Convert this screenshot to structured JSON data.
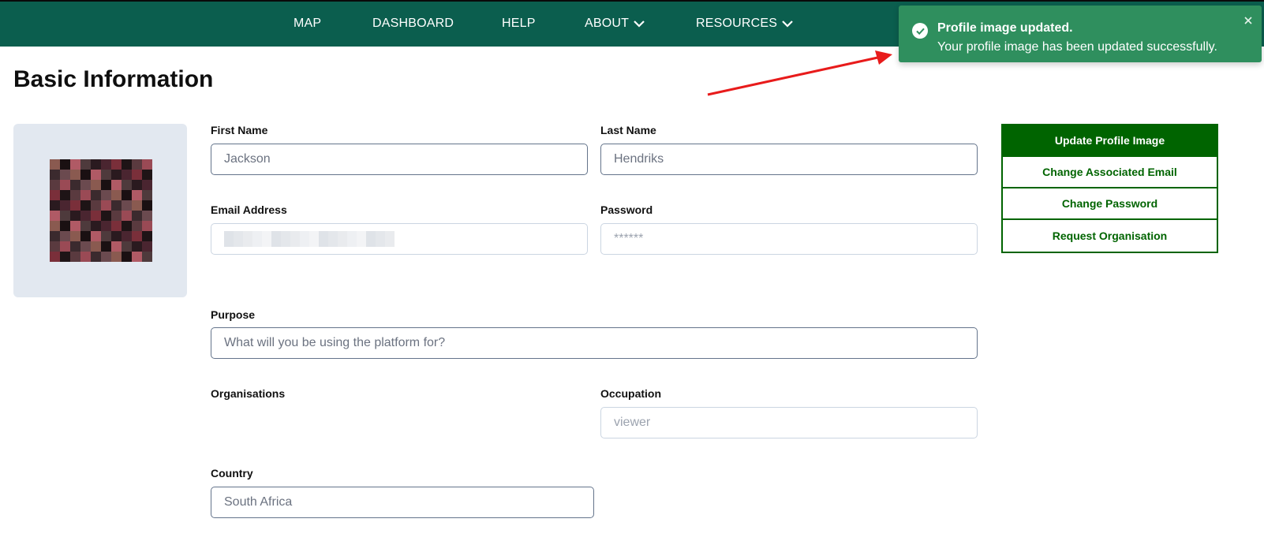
{
  "nav": {
    "items": [
      {
        "label": "MAP",
        "has_dropdown": false
      },
      {
        "label": "DASHBOARD",
        "has_dropdown": false
      },
      {
        "label": "HELP",
        "has_dropdown": false
      },
      {
        "label": "ABOUT",
        "has_dropdown": true,
        "icon": "chevron-down-icon"
      },
      {
        "label": "RESOURCES",
        "has_dropdown": true,
        "icon": "chevron-down-icon"
      }
    ],
    "background": "#0b5e4e"
  },
  "page": {
    "title": "Basic Information"
  },
  "form": {
    "first_name": {
      "label": "First Name",
      "value": "Jackson"
    },
    "last_name": {
      "label": "Last Name",
      "value": "Hendriks"
    },
    "email": {
      "label": "Email Address",
      "value": ""
    },
    "password": {
      "label": "Password",
      "placeholder": "******"
    },
    "purpose": {
      "label": "Purpose",
      "placeholder": "What will you be using the platform for?"
    },
    "organisations": {
      "label": "Organisations"
    },
    "occupation": {
      "label": "Occupation",
      "value": "viewer"
    },
    "country": {
      "label": "Country",
      "value": "South Africa"
    }
  },
  "actions": {
    "update_profile_image": "Update Profile Image",
    "change_email": "Change Associated Email",
    "change_password": "Change Password",
    "request_organisation": "Request Organisation",
    "accent": "#006400"
  },
  "toast": {
    "title": "Profile image updated.",
    "message": "Your profile image has been updated successfully.",
    "icon": "check-circle-icon",
    "close_icon": "close-icon",
    "background": "#2f8f5e"
  },
  "annotation": {
    "arrow_color": "#e81b1b"
  }
}
